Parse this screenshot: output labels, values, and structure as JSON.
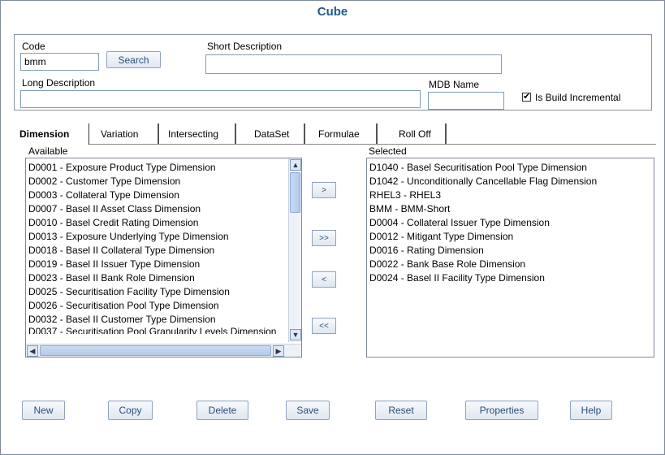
{
  "window": {
    "title": "Cube"
  },
  "fields": {
    "code_label": "Code",
    "code_value": "bmm",
    "search_label": "Search",
    "short_desc_label": "Short Description",
    "short_desc_value": "",
    "long_desc_label": "Long Description",
    "long_desc_value": "",
    "mdb_name_label": "MDB Name",
    "mdb_name_value": "",
    "incremental_label": "Is Build Incremental",
    "incremental_checked": "✔"
  },
  "tabs": [
    {
      "label": "Dimension"
    },
    {
      "label": "Variation"
    },
    {
      "label": "Intersecting"
    },
    {
      "label": "DataSet"
    },
    {
      "label": "Formulae"
    },
    {
      "label": "Roll Off"
    }
  ],
  "available": {
    "label": "Available",
    "items": [
      "D0001 - Exposure Product Type Dimension",
      "D0002 - Customer Type Dimension",
      "D0003 - Collateral Type Dimension",
      "D0007 - Basel II Asset Class Dimension",
      "D0010 - Basel Credit Rating Dimension",
      "D0013 - Exposure Underlying Type Dimension",
      "D0018 - Basel II Collateral Type Dimension",
      "D0019 - Basel II Issuer Type Dimension",
      "D0023 - Basel II Bank Role Dimension",
      "D0025 - Securitisation Facility Type Dimension",
      "D0026 - Securitisation Pool Type Dimension",
      "D0032 - Basel II Customer Type Dimension",
      "D0037 - Securitisation Pool Granularity Levels Dimension"
    ]
  },
  "selected": {
    "label": "Selected",
    "items": [
      "D1040 - Basel Securitisation Pool Type Dimension",
      "D1042 - Unconditionally Cancellable Flag Dimension",
      "RHEL3 - RHEL3",
      "BMM - BMM-Short",
      "D0004 - Collateral Issuer Type Dimension",
      "D0012 - Mitigant Type Dimension",
      "D0016 - Rating Dimension",
      "D0022 - Bank Base Role Dimension",
      "D0024 - Basel II Facility Type Dimension"
    ]
  },
  "move_buttons": {
    "add": ">",
    "add_all": ">>",
    "remove": "<",
    "remove_all": "<<"
  },
  "actions": {
    "new": "New",
    "copy": "Copy",
    "delete": "Delete",
    "save": "Save",
    "reset": "Reset",
    "properties": "Properties",
    "help": "Help"
  },
  "colors": {
    "title": "#1f5b8c",
    "button_text": "#2a4e7a",
    "border": "#7f9db9"
  }
}
